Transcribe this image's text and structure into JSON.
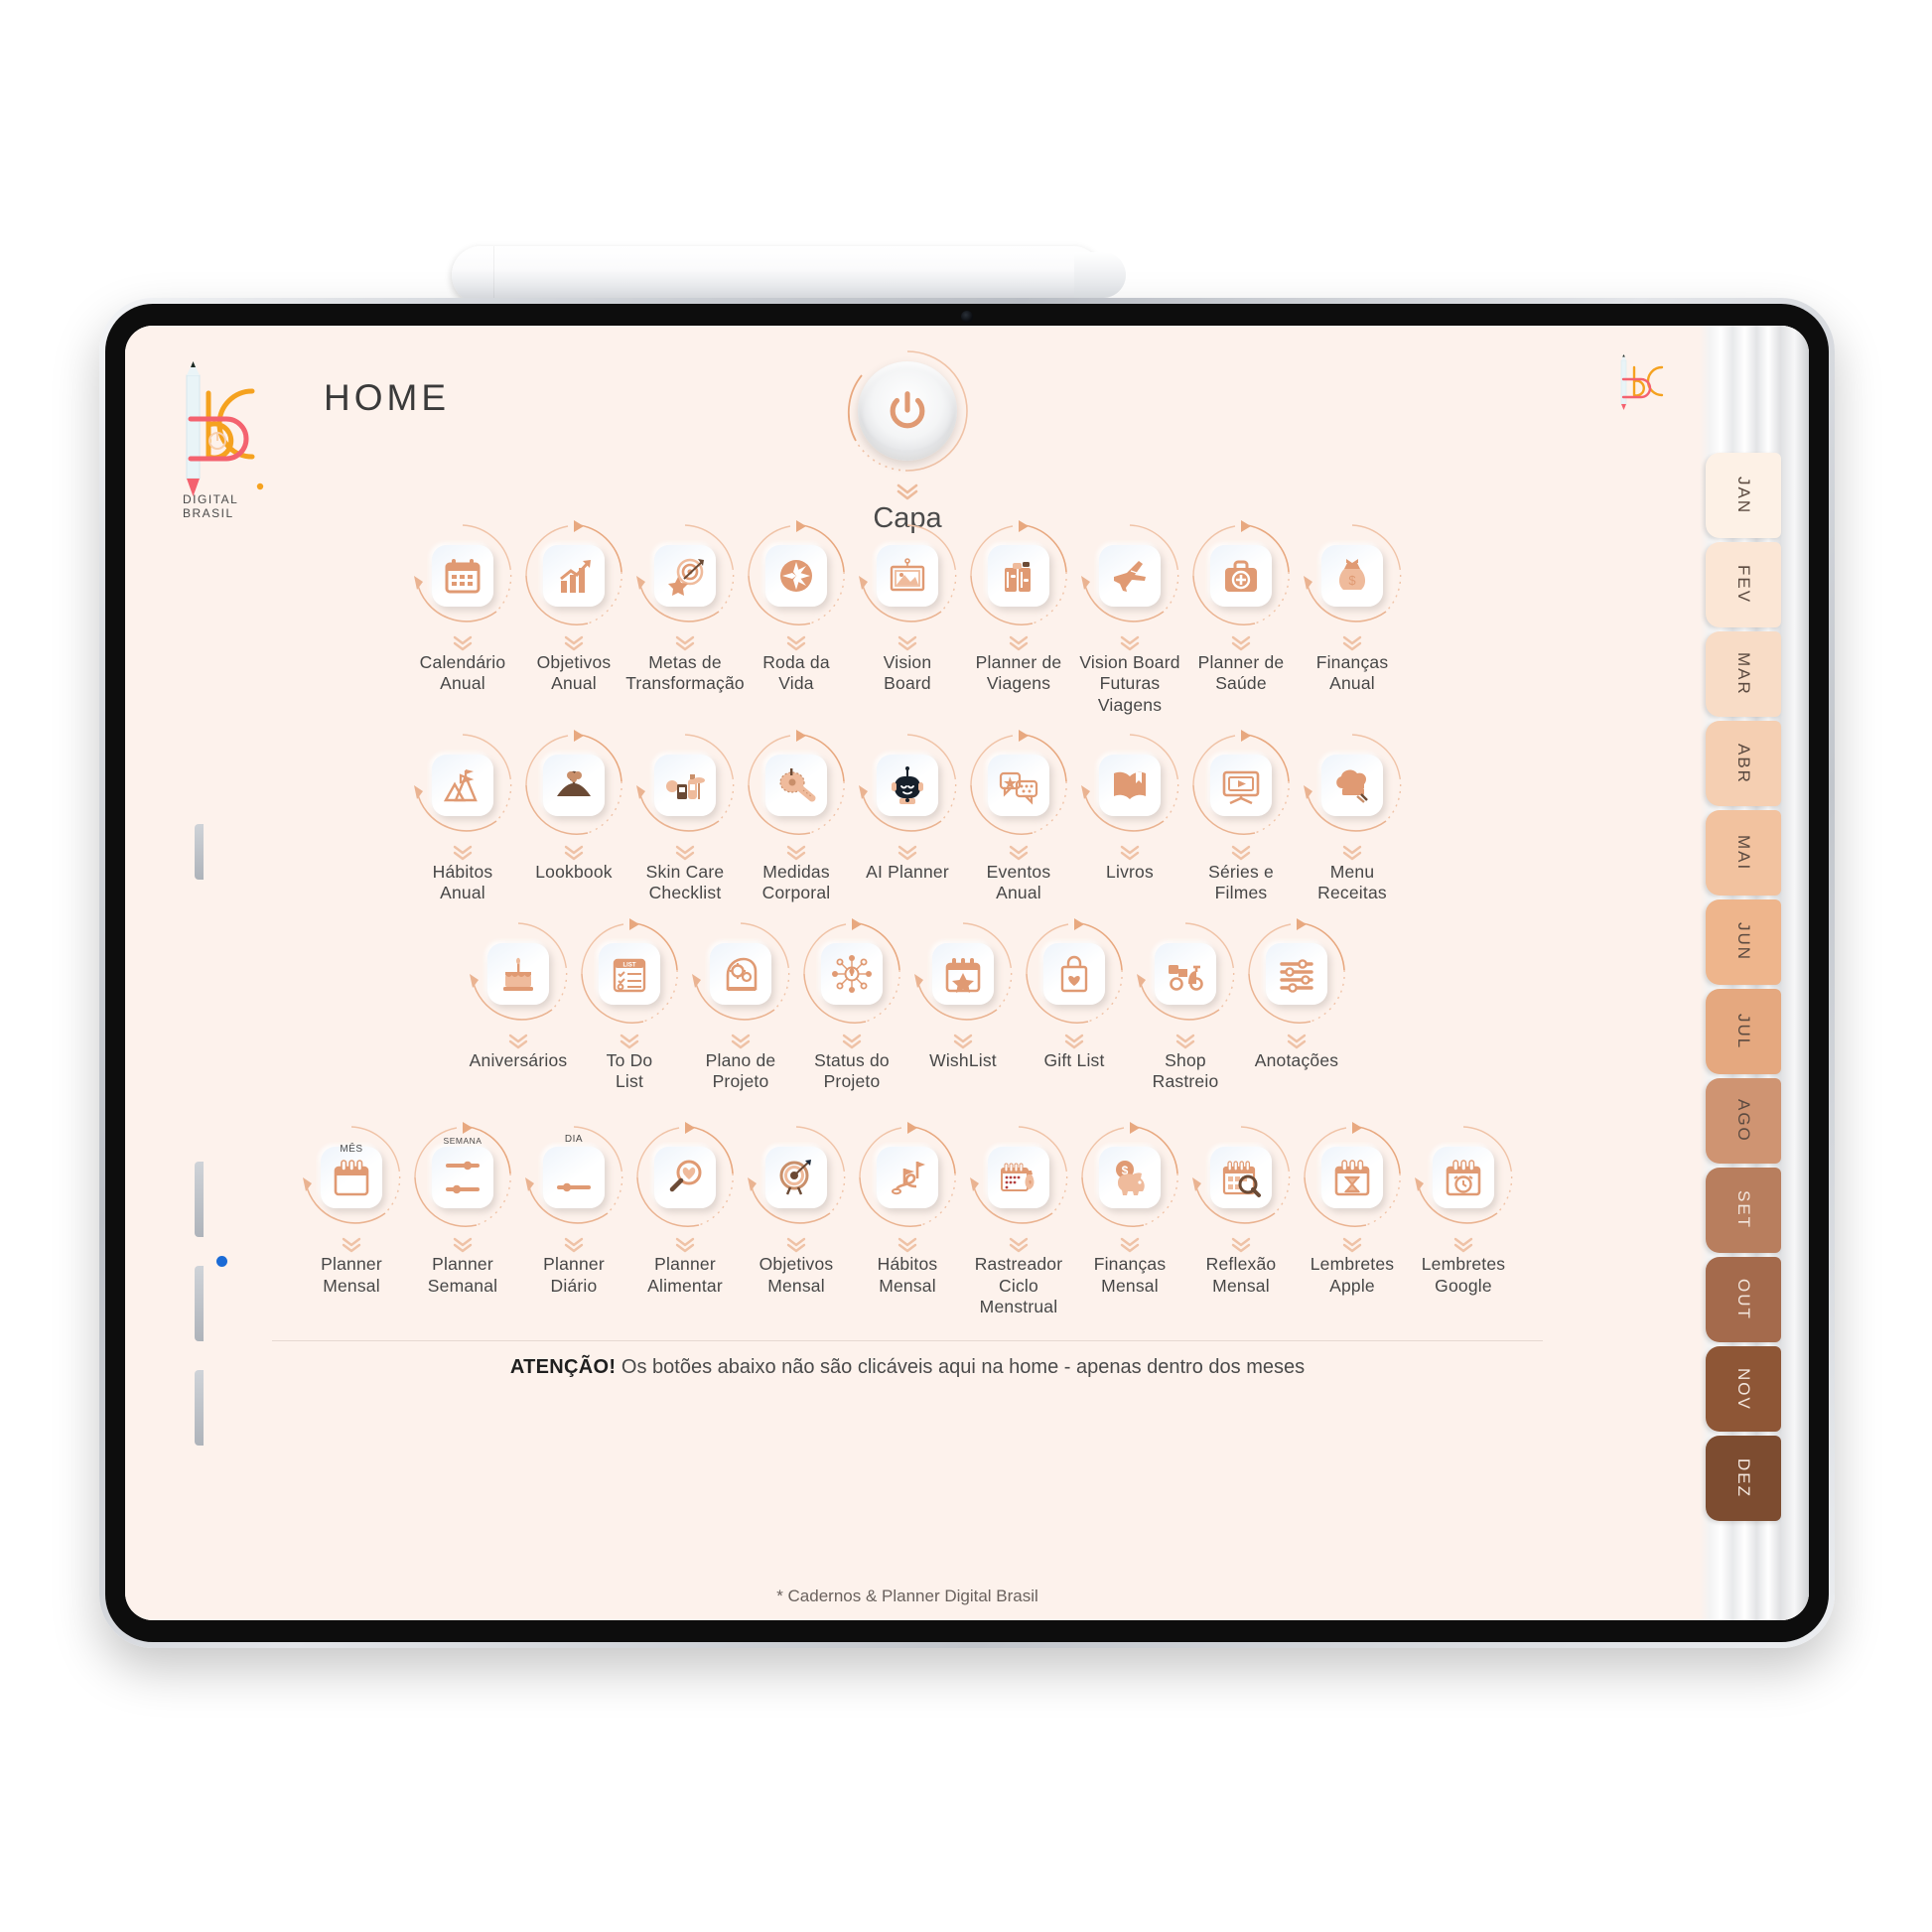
{
  "device": {
    "kind": "tablet",
    "accessory": "stylus-pencil"
  },
  "brand": {
    "title": "HOME",
    "sub": "DIGITAL BRASIL"
  },
  "cover": {
    "icon": "power-icon",
    "label": "Capa"
  },
  "notice": {
    "strong": "ATENÇÃO!",
    "text": " Os botões abaixo não são clicáveis aqui na home - apenas dentro dos meses"
  },
  "footer": "* Cadernos & Planner Digital Brasil",
  "colors": {
    "page_bg": "#fdf2ec",
    "accent": "#e09a73",
    "accent_soft": "#f2c5ab",
    "text": "#474747",
    "logo_orange": "#f5a21f",
    "logo_pink": "#f4626f"
  },
  "rows": [
    {
      "name": "annual-tools-row-1",
      "items": [
        {
          "label": "Calendário\nAnual",
          "icon": "calendar-icon"
        },
        {
          "label": "Objetivos\nAnual",
          "icon": "chart-growth-icon"
        },
        {
          "label": "Metas de\nTransformação",
          "icon": "target-star-icon"
        },
        {
          "label": "Roda da\nVida",
          "icon": "wheel-of-life-icon"
        },
        {
          "label": "Vision\nBoard",
          "icon": "framed-picture-icon"
        },
        {
          "label": "Planner de\nViagens",
          "icon": "suitcase-icon"
        },
        {
          "label": "Vision Board\nFuturas Viagens",
          "icon": "airplane-icon"
        },
        {
          "label": "Planner de\nSaúde",
          "icon": "first-aid-kit-icon"
        },
        {
          "label": "Finanças\nAnual",
          "icon": "money-bag-icon"
        }
      ]
    },
    {
      "name": "annual-tools-row-2",
      "items": [
        {
          "label": "Hábitos\nAnual",
          "icon": "mountain-flag-icon"
        },
        {
          "label": "Lookbook",
          "icon": "clothes-hanger-icon"
        },
        {
          "label": "Skin Care\nChecklist",
          "icon": "cosmetics-icon"
        },
        {
          "label": "Medidas\nCorporal",
          "icon": "measuring-tape-icon"
        },
        {
          "label": "AI Planner",
          "icon": "robot-icon"
        },
        {
          "label": "Eventos\nAnual",
          "icon": "review-chat-icon"
        },
        {
          "label": "Livros",
          "icon": "open-book-icon"
        },
        {
          "label": "Séries e\nFilmes",
          "icon": "tv-play-icon"
        },
        {
          "label": "Menu\nReceitas",
          "icon": "chef-hat-icon"
        }
      ]
    },
    {
      "name": "annual-tools-row-3",
      "items": [
        {
          "label": "Aniversários",
          "icon": "birthday-cake-icon"
        },
        {
          "label": "To Do\nList",
          "icon": "checklist-icon"
        },
        {
          "label": "Plano de\nProjeto",
          "icon": "head-gears-icon"
        },
        {
          "label": "Status do\nProjeto",
          "icon": "idea-network-icon"
        },
        {
          "label": "WishList",
          "icon": "calendar-star-icon"
        },
        {
          "label": "Gift List",
          "icon": "gift-bag-heart-icon"
        },
        {
          "label": "Shop\nRastreio",
          "icon": "delivery-scooter-icon"
        },
        {
          "label": "Anotações",
          "icon": "sliders-icon"
        }
      ]
    },
    {
      "name": "monthly-tools-row-4",
      "items": [
        {
          "label": "Planner\nMensal",
          "icon": "calendar-mes-icon",
          "badge": "MÊS"
        },
        {
          "label": "Planner\nSemanal",
          "icon": "semana-slider-icon",
          "badge": "SEMANA"
        },
        {
          "label": "Planner\nDiário",
          "icon": "dia-slider-icon",
          "badge": "DIA"
        },
        {
          "label": "Planner\nAlimentar",
          "icon": "magnifier-apple-icon"
        },
        {
          "label": "Objetivos\nMensal",
          "icon": "dartboard-arrow-icon"
        },
        {
          "label": "Hábitos\nMensal",
          "icon": "path-flags-icon"
        },
        {
          "label": "Rastreador\nCiclo Menstrual",
          "icon": "menstrual-calendar-icon"
        },
        {
          "label": "Finanças\nMensal",
          "icon": "piggy-bank-icon"
        },
        {
          "label": "Reflexão\nMensal",
          "icon": "calendar-search-icon"
        },
        {
          "label": "Lembretes\nApple",
          "icon": "calendar-hourglass-icon"
        },
        {
          "label": "Lembretes\nGoogle",
          "icon": "calendar-alarm-icon"
        }
      ]
    }
  ],
  "month_tabs": [
    {
      "label": "JAN",
      "color": "#fdf1e6"
    },
    {
      "label": "FEV",
      "color": "#fbe6d5"
    },
    {
      "label": "MAR",
      "color": "#f8dcc6"
    },
    {
      "label": "ABR",
      "color": "#f5cfb2"
    },
    {
      "label": "MAI",
      "color": "#f2c29f"
    },
    {
      "label": "JUN",
      "color": "#eeb58c"
    },
    {
      "label": "JUL",
      "color": "#e5a87f"
    },
    {
      "label": "AGO",
      "color": "#cf9472"
    },
    {
      "label": "SET",
      "color": "#b87e5e"
    },
    {
      "label": "OUT",
      "color": "#a46a4c"
    },
    {
      "label": "NOV",
      "color": "#8e5636"
    },
    {
      "label": "DEZ",
      "color": "#7d4c30"
    }
  ]
}
